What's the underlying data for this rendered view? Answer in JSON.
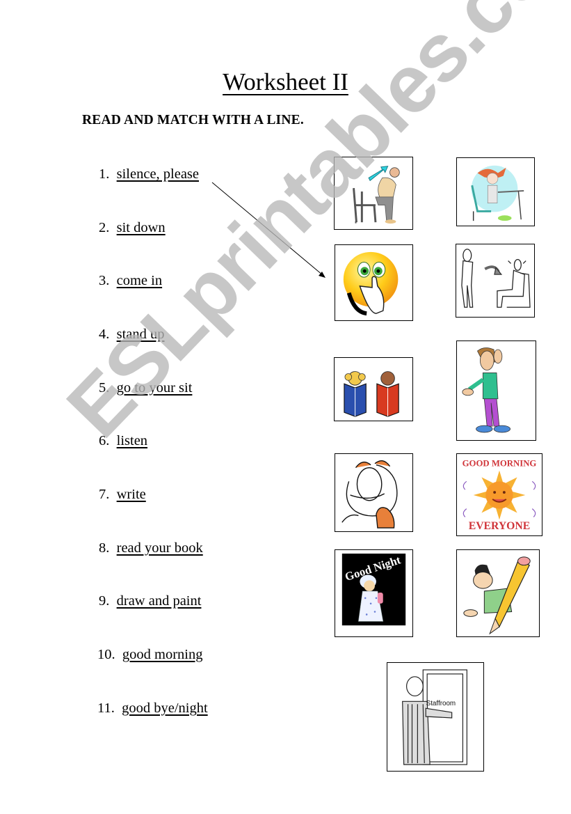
{
  "title": "Worksheet II",
  "instruction": "READ AND MATCH WITH A LINE.",
  "items": [
    {
      "num": "1.",
      "text": "silence, please"
    },
    {
      "num": "2.",
      "text": "sit down"
    },
    {
      "num": "3.",
      "text": "come in"
    },
    {
      "num": "4.",
      "text": "stand up"
    },
    {
      "num": "5.",
      "text": "go to your sit"
    },
    {
      "num": "6.",
      "text": "listen"
    },
    {
      "num": "7.",
      "text": "write"
    },
    {
      "num": "8.",
      "text": "read your book"
    },
    {
      "num": "9.",
      "text": "draw and paint"
    },
    {
      "num": "10.",
      "text": "good morning"
    },
    {
      "num": "11.",
      "text": "good bye/night"
    }
  ],
  "pictures": [
    {
      "id": "stand-up",
      "caption": ""
    },
    {
      "id": "sit-at-desk",
      "caption": ""
    },
    {
      "id": "silence-smiley",
      "caption": ""
    },
    {
      "id": "sit-down-figures",
      "caption": ""
    },
    {
      "id": "read-books",
      "caption": ""
    },
    {
      "id": "listen-man",
      "caption": ""
    },
    {
      "id": "garfield",
      "caption": ""
    },
    {
      "id": "good-morning-sun",
      "caption_top": "GOOD MORNING",
      "caption_bottom": "EVERYONE"
    },
    {
      "id": "good-night-girl",
      "caption": "Good Night"
    },
    {
      "id": "write-pencil",
      "caption": ""
    },
    {
      "id": "come-in-staffroom",
      "caption": "Staffroom"
    }
  ],
  "watermark": "ESLprintables.com"
}
